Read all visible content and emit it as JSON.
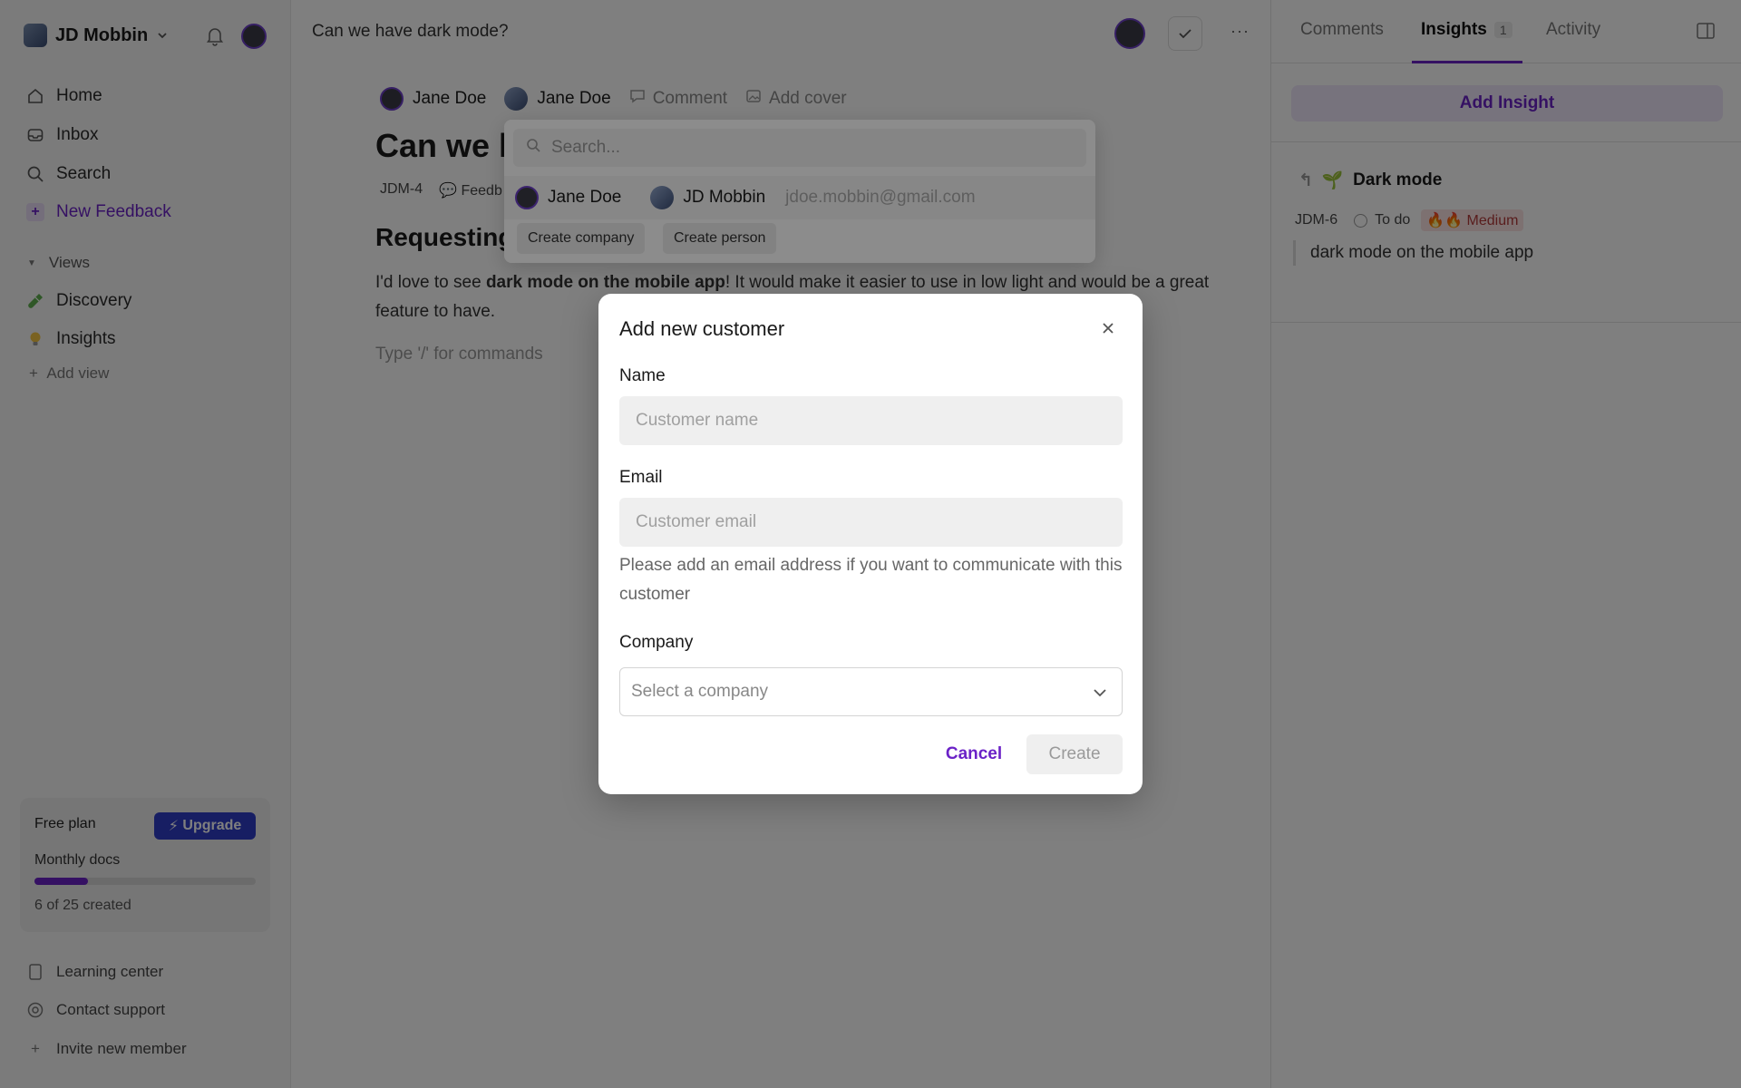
{
  "sidebar": {
    "workspace": "JD Mobbin",
    "nav": [
      {
        "label": "Home",
        "icon": "home-icon"
      },
      {
        "label": "Inbox",
        "icon": "inbox-icon"
      },
      {
        "label": "Search",
        "icon": "search-icon"
      },
      {
        "label": "New Feedback",
        "icon": "plus-icon"
      }
    ],
    "views_header": "Views",
    "views": [
      {
        "label": "Discovery",
        "icon": "test-tube-icon"
      },
      {
        "label": "Insights",
        "icon": "lightbulb-icon"
      }
    ],
    "add_view": "Add view",
    "plan": {
      "title": "Free plan",
      "upgrade": "Upgrade",
      "subtitle": "Monthly docs",
      "used": 6,
      "total": 25,
      "count_text": "6 of 25 created"
    },
    "footer": [
      {
        "label": "Learning center",
        "icon": "book-icon"
      },
      {
        "label": "Contact support",
        "icon": "support-icon"
      },
      {
        "label": "Invite new member",
        "icon": "plus-icon"
      }
    ]
  },
  "main": {
    "doc_title": "Can we have dark mode?",
    "meta": {
      "person1": "Jane Doe",
      "person2": "Jane Doe",
      "comment": "Comment",
      "add_cover": "Add cover"
    },
    "title": "Can we h",
    "tags": {
      "id": "JDM-4",
      "type": "Feedb"
    },
    "heading": "Requesting",
    "para_pre": "I'd love to see ",
    "para_bold": "dark mode on the mobile app",
    "para_post": "! It would make it easier to use in low light and would be a great feature to have.",
    "cmd_hint": "Type '/' for commands"
  },
  "right": {
    "tabs": [
      "Comments",
      "Insights",
      "Activity"
    ],
    "insights_count": "1",
    "add_insight": "Add Insight",
    "insight": {
      "title": "Dark mode",
      "id": "JDM-6",
      "status": "To do",
      "priority": "🔥🔥 Medium",
      "quote": "dark mode on the mobile app"
    }
  },
  "dropdown": {
    "search_placeholder": "Search...",
    "person1": "Jane Doe",
    "person2": "JD Mobbin",
    "email": "jdoe.mobbin@gmail.com",
    "create_company": "Create company",
    "create_person": "Create person"
  },
  "modal": {
    "title": "Add new customer",
    "name_label": "Name",
    "name_placeholder": "Customer name",
    "email_label": "Email",
    "email_placeholder": "Customer email",
    "email_help": "Please add an email address if you want to communicate with this customer",
    "company_label": "Company",
    "company_placeholder": "Select a company",
    "cancel": "Cancel",
    "create": "Create"
  },
  "colors": {
    "accent": "#6b22c7",
    "upgrade": "#2f3cc7",
    "overlay": "rgba(0,0,0,0.5)"
  }
}
